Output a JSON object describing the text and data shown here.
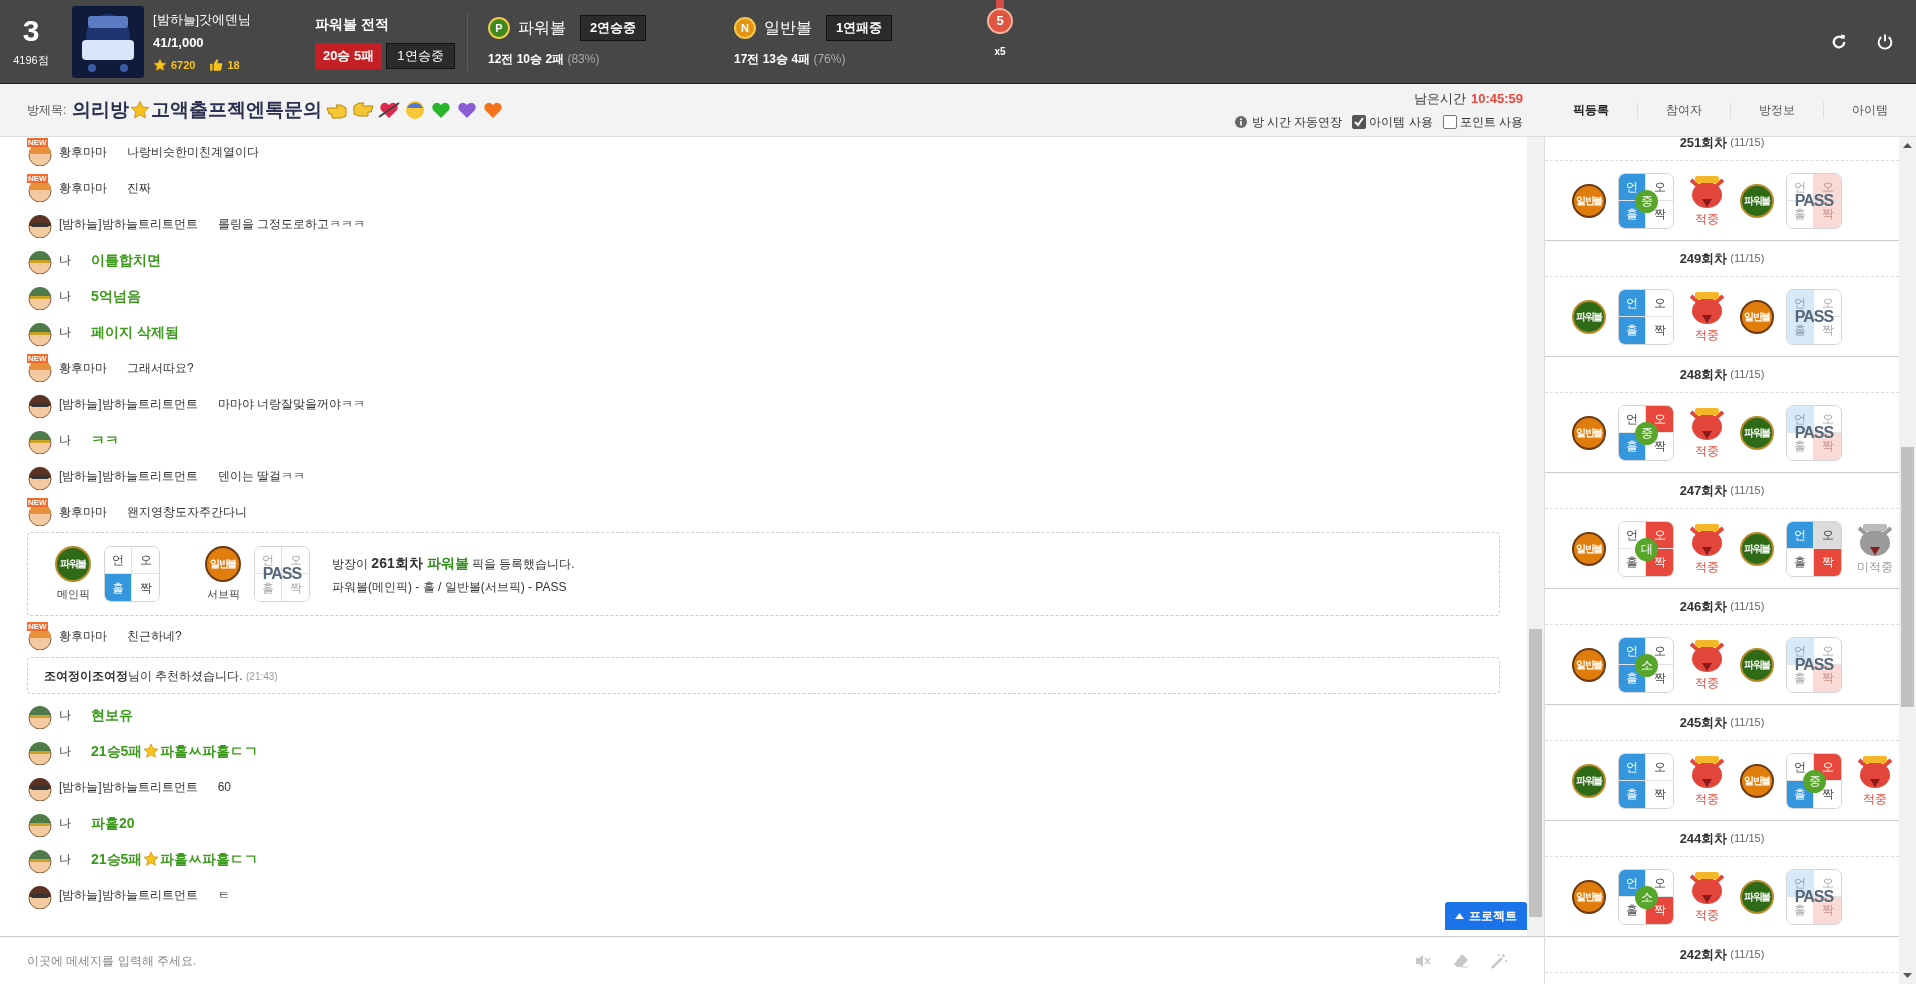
{
  "header": {
    "rank": "3",
    "points": "4196점",
    "user": {
      "name": "[밤하늘]갓에덴님",
      "progress": "41/1,000",
      "star_points": "6720",
      "likes": "18"
    },
    "record": {
      "title": "파워볼 전적",
      "result": "20승 5패",
      "streak": "1연승중"
    },
    "games": [
      {
        "kind": "power",
        "icon": "P",
        "name": "파워볼",
        "streak": "2연승중",
        "total": "12전",
        "wins": "10승",
        "losses": "2패",
        "rate": "(83%)"
      },
      {
        "kind": "normal",
        "icon": "N",
        "name": "일반볼",
        "streak": "1연패중",
        "total": "17전",
        "wins": "13승",
        "losses": "4패",
        "rate": "(76%)"
      }
    ],
    "medal": {
      "number": "5",
      "multiplier": "x5"
    }
  },
  "room": {
    "label": "방제목:",
    "title_start": "의리방",
    "title_end": "고액출프젝엔톡문의",
    "time_label": "남은시간",
    "time": "10:45:59",
    "options": [
      {
        "kind": "info",
        "label": "방 시간 자동연장"
      },
      {
        "kind": "checkbox",
        "label": "아이템 사용",
        "checked": true
      },
      {
        "kind": "checkbox",
        "label": "포인트 사용",
        "checked": false
      }
    ]
  },
  "tabs": [
    {
      "label": "픽등록",
      "selected": true
    },
    {
      "label": "참여자",
      "selected": false
    },
    {
      "label": "방정보",
      "selected": false
    },
    {
      "label": "아이템",
      "selected": false
    }
  ],
  "messages": [
    {
      "kind": "chat",
      "avatar": {
        "kind": "new",
        "badge": "NEW"
      },
      "name": "황후마마",
      "text": "나랑비슷한미친계열이다",
      "self": false
    },
    {
      "kind": "chat",
      "avatar": {
        "kind": "new",
        "badge": "NEW"
      },
      "name": "황후마마",
      "text": "진짜",
      "self": false
    },
    {
      "kind": "chat",
      "avatar": {
        "kind": "goggles"
      },
      "name": "[밤하늘]밤하늘트리트먼트",
      "text": "롤링을 그정도로하고ㅋㅋㅋ",
      "self": false
    },
    {
      "kind": "chat",
      "avatar": {
        "kind": "soldier"
      },
      "name": "나",
      "text": "이틀합치면",
      "self": true
    },
    {
      "kind": "chat",
      "avatar": {
        "kind": "soldier"
      },
      "name": "나",
      "text": "5억넘음",
      "self": true
    },
    {
      "kind": "chat",
      "avatar": {
        "kind": "soldier"
      },
      "name": "나",
      "text": "페이지 삭제됨",
      "self": true
    },
    {
      "kind": "chat",
      "avatar": {
        "kind": "new",
        "badge": "NEW"
      },
      "name": "황후마마",
      "text": "그래서따요?",
      "self": false
    },
    {
      "kind": "chat",
      "avatar": {
        "kind": "goggles"
      },
      "name": "[밤하늘]밤하늘트리트먼트",
      "text": "마마야 너랑잘맞을꺼야ㅋㅋ",
      "self": false
    },
    {
      "kind": "chat",
      "avatar": {
        "kind": "soldier"
      },
      "name": "나",
      "text": "ㅋㅋ",
      "self": true
    },
    {
      "kind": "chat",
      "avatar": {
        "kind": "goggles"
      },
      "name": "[밤하늘]밤하늘트리트먼트",
      "text": "덴이는 딸걸ㅋㅋ",
      "self": false
    },
    {
      "kind": "chat",
      "avatar": {
        "kind": "new",
        "badge": "NEW"
      },
      "name": "황후마마",
      "text": "왠지영창도자주간다니",
      "self": false
    },
    {
      "kind": "pick",
      "main": {
        "ball": {
          "kind": "power",
          "label": "파워볼"
        },
        "caption": "메인픽",
        "pass": false,
        "cells": [
          {
            "label": "언",
            "kind": "none"
          },
          {
            "label": "오",
            "kind": "none"
          },
          {
            "label": "홀",
            "kind": "pick"
          },
          {
            "label": "짝",
            "kind": "none"
          }
        ]
      },
      "sub": {
        "ball": {
          "kind": "normal",
          "label": "일반볼"
        },
        "caption": "서브픽",
        "pass": true,
        "pass_label": "PASS",
        "cells": [
          {
            "label": "언",
            "kind": "none"
          },
          {
            "label": "오",
            "kind": "none"
          },
          {
            "label": "홀",
            "kind": "none"
          },
          {
            "label": "짝",
            "kind": "none"
          }
        ]
      },
      "line1": {
        "before": "방장이",
        "round": "261회차",
        "game": "파워볼",
        "after": "픽을 등록했습니다."
      },
      "line2": "파워볼(메인픽) - 홀 / 일반볼(서브픽) - PASS"
    },
    {
      "kind": "chat",
      "avatar": {
        "kind": "new",
        "badge": "NEW"
      },
      "name": "황후마마",
      "text": "친근하네?",
      "self": false
    },
    {
      "kind": "system",
      "name": "조여정이조여정",
      "text": "님이 추천하셨습니다.",
      "time": "(21:43)"
    },
    {
      "kind": "chat",
      "avatar": {
        "kind": "soldier"
      },
      "name": "나",
      "text": "현보유",
      "self": true
    },
    {
      "kind": "chat",
      "avatar": {
        "kind": "soldier"
      },
      "name": "나",
      "text": "21승5패",
      "text_after_star": "파홀ㅆ파홀ㄷㄱ",
      "self": true
    },
    {
      "kind": "chat",
      "avatar": {
        "kind": "goggles"
      },
      "name": "[밤하늘]밤하늘트리트먼트",
      "text": "60",
      "self": false
    },
    {
      "kind": "chat",
      "avatar": {
        "kind": "soldier"
      },
      "name": "나",
      "text": "파홀20",
      "self": true
    },
    {
      "kind": "chat",
      "avatar": {
        "kind": "soldier"
      },
      "name": "나",
      "text": "21승5패",
      "text_after_star": "파홀ㅆ파홀ㄷㄱ",
      "self": true
    },
    {
      "kind": "chat",
      "avatar": {
        "kind": "goggles"
      },
      "name": "[밤하늘]밤하늘트리트먼트",
      "text": "ㅌ",
      "self": false
    }
  ],
  "project_button": {
    "label": "프로젝트"
  },
  "input": {
    "placeholder": "이곳에 메세지를 입력해 주세요."
  },
  "rounds": [
    {
      "title": "251회차",
      "count": "(11/15)",
      "picks": [
        {
          "ball": {
            "kind": "normal",
            "label": "일반볼"
          },
          "pass": false,
          "size": "중",
          "result": {
            "kind": "hit",
            "label": "적중"
          },
          "cells": [
            {
              "label": "언",
              "kind": "pick"
            },
            {
              "label": "오",
              "kind": "none"
            },
            {
              "label": "홀",
              "kind": "pick"
            },
            {
              "label": "짝",
              "kind": "none"
            }
          ]
        },
        {
          "ball": {
            "kind": "power",
            "label": "파워볼"
          },
          "pass": true,
          "pass_label": "PASS",
          "cells": [
            {
              "label": "언",
              "kind": "none"
            },
            {
              "label": "오",
              "kind": "result"
            },
            {
              "label": "홀",
              "kind": "none"
            },
            {
              "label": "짝",
              "kind": "result"
            }
          ]
        }
      ]
    },
    {
      "title": "249회차",
      "count": "(11/15)",
      "picks": [
        {
          "ball": {
            "kind": "power",
            "label": "파워볼"
          },
          "pass": false,
          "result": {
            "kind": "hit",
            "label": "적중"
          },
          "cells": [
            {
              "label": "언",
              "kind": "pick"
            },
            {
              "label": "오",
              "kind": "none"
            },
            {
              "label": "홀",
              "kind": "pick"
            },
            {
              "label": "짝",
              "kind": "none"
            }
          ]
        },
        {
          "ball": {
            "kind": "normal",
            "label": "일반볼"
          },
          "pass": true,
          "pass_label": "PASS",
          "cells": [
            {
              "label": "언",
              "kind": "pick"
            },
            {
              "label": "오",
              "kind": "none"
            },
            {
              "label": "홀",
              "kind": "pick"
            },
            {
              "label": "짝",
              "kind": "none"
            }
          ]
        }
      ]
    },
    {
      "title": "248회차",
      "count": "(11/15)",
      "picks": [
        {
          "ball": {
            "kind": "normal",
            "label": "일반볼"
          },
          "pass": false,
          "size": "중",
          "result": {
            "kind": "hit",
            "label": "적중"
          },
          "cells": [
            {
              "label": "언",
              "kind": "none"
            },
            {
              "label": "오",
              "kind": "result"
            },
            {
              "label": "홀",
              "kind": "pick"
            },
            {
              "label": "짝",
              "kind": "none"
            }
          ]
        },
        {
          "ball": {
            "kind": "power",
            "label": "파워볼"
          },
          "pass": true,
          "pass_label": "PASS",
          "cells": [
            {
              "label": "언",
              "kind": "pick"
            },
            {
              "label": "오",
              "kind": "none"
            },
            {
              "label": "홀",
              "kind": "none"
            },
            {
              "label": "짝",
              "kind": "result"
            }
          ]
        }
      ]
    },
    {
      "title": "247회차",
      "count": "(11/15)",
      "picks": [
        {
          "ball": {
            "kind": "normal",
            "label": "일반볼"
          },
          "pass": false,
          "size": "대",
          "result": {
            "kind": "hit",
            "label": "적중"
          },
          "cells": [
            {
              "label": "언",
              "kind": "none"
            },
            {
              "label": "오",
              "kind": "result"
            },
            {
              "label": "홀",
              "kind": "none"
            },
            {
              "label": "짝",
              "kind": "result"
            }
          ]
        },
        {
          "ball": {
            "kind": "power",
            "label": "파워볼"
          },
          "pass": false,
          "result": {
            "kind": "miss",
            "label": "미적중"
          },
          "cells": [
            {
              "label": "언",
              "kind": "pick"
            },
            {
              "label": "오",
              "kind": "muted"
            },
            {
              "label": "홀",
              "kind": "none"
            },
            {
              "label": "짝",
              "kind": "result"
            }
          ]
        }
      ]
    },
    {
      "title": "246회차",
      "count": "(11/15)",
      "picks": [
        {
          "ball": {
            "kind": "normal",
            "label": "일반볼"
          },
          "pass": false,
          "size": "소",
          "result": {
            "kind": "hit",
            "label": "적중"
          },
          "cells": [
            {
              "label": "언",
              "kind": "pick"
            },
            {
              "label": "오",
              "kind": "none"
            },
            {
              "label": "홀",
              "kind": "pick"
            },
            {
              "label": "짝",
              "kind": "none"
            }
          ]
        },
        {
          "ball": {
            "kind": "power",
            "label": "파워볼"
          },
          "pass": true,
          "pass_label": "PASS",
          "cells": [
            {
              "label": "언",
              "kind": "pick"
            },
            {
              "label": "오",
              "kind": "none"
            },
            {
              "label": "홀",
              "kind": "none"
            },
            {
              "label": "짝",
              "kind": "result"
            }
          ]
        }
      ]
    },
    {
      "title": "245회차",
      "count": "(11/15)",
      "picks": [
        {
          "ball": {
            "kind": "power",
            "label": "파워볼"
          },
          "pass": false,
          "result": {
            "kind": "hit",
            "label": "적중"
          },
          "cells": [
            {
              "label": "언",
              "kind": "pick"
            },
            {
              "label": "오",
              "kind": "none"
            },
            {
              "label": "홀",
              "kind": "pick"
            },
            {
              "label": "짝",
              "kind": "none"
            }
          ]
        },
        {
          "ball": {
            "kind": "normal",
            "label": "일반볼"
          },
          "pass": false,
          "size": "중",
          "result": {
            "kind": "hit",
            "label": "적중"
          },
          "cells": [
            {
              "label": "언",
              "kind": "none"
            },
            {
              "label": "오",
              "kind": "result"
            },
            {
              "label": "홀",
              "kind": "pick"
            },
            {
              "label": "짝",
              "kind": "none"
            }
          ]
        }
      ]
    },
    {
      "title": "244회차",
      "count": "(11/15)",
      "picks": [
        {
          "ball": {
            "kind": "normal",
            "label": "일반볼"
          },
          "pass": false,
          "size": "소",
          "result": {
            "kind": "hit",
            "label": "적중"
          },
          "cells": [
            {
              "label": "언",
              "kind": "pick"
            },
            {
              "label": "오",
              "kind": "none"
            },
            {
              "label": "홀",
              "kind": "none"
            },
            {
              "label": "짝",
              "kind": "result"
            }
          ]
        },
        {
          "ball": {
            "kind": "power",
            "label": "파워볼"
          },
          "pass": true,
          "pass_label": "PASS",
          "cells": [
            {
              "label": "언",
              "kind": "pick"
            },
            {
              "label": "오",
              "kind": "none"
            },
            {
              "label": "홀",
              "kind": "none"
            },
            {
              "label": "짝",
              "kind": "result"
            }
          ]
        }
      ]
    },
    {
      "title": "242회차",
      "count": "(11/15)"
    }
  ]
}
